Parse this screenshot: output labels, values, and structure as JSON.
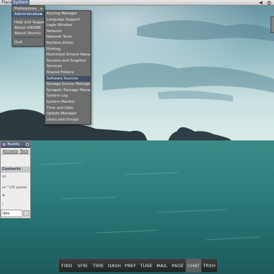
{
  "top_panel": {
    "places": "Places",
    "system": "System",
    "icons": [
      "volume-icon",
      "power-icon"
    ]
  },
  "system_menu": {
    "items": [
      "Preferences",
      "Administration",
      "Help and Support",
      "About GNOME",
      "About Ubuntu",
      "Quit"
    ],
    "submenu_arrow": "▸"
  },
  "administration_menu": {
    "items": [
      "Keyring Manager",
      "Language Support",
      "Login Window",
      "Network",
      "Network Tools",
      "Partition Editor",
      "Printing",
      "Restricted Drivers Manager",
      "Screens and Graphics",
      "Services",
      "Shared Folders",
      "Software Sources",
      "Storage Device Manager",
      "Synaptic Package Manager",
      "System Log",
      "System Monitor",
      "Time and Date",
      "Update Manager",
      "Users and Groups"
    ],
    "highlighted": "Software Sources"
  },
  "buddy_list": {
    "title": "Buddy...",
    "menus": [
      "Accounts",
      "Tools"
    ],
    "header": "Contacts",
    "rows": [
      "en",
      "se \"125 paviet",
      "#",
      "/"
    ],
    "status": "ible"
  },
  "dock": {
    "items": [
      "FIND",
      "SFRI",
      "TIME",
      "DASH",
      "PREF",
      "TUNE",
      "MAIL",
      "PAGE",
      "CHAT",
      "TRSH"
    ],
    "active": "CHAT"
  },
  "colors": {
    "panel": "#d8d8d8",
    "menu_bg": "#6d6f6f",
    "menu_highlight": "#3d4f67",
    "sea": "#2f8a86",
    "sky": "#9fc3c9"
  }
}
